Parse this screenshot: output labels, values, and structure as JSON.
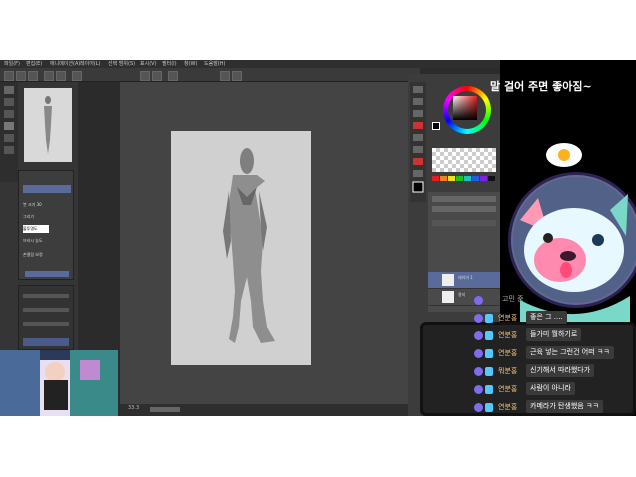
{
  "app": {
    "window_title": "",
    "menus": [
      "파일(F)",
      "편집(E)",
      "애니메이션(A)",
      "레이어(L)",
      "선택 범위(S)",
      "표시(V)",
      "필터(I)",
      "창(W)",
      "도움말(H)"
    ],
    "subtool_items": [
      "붓 크기 30",
      "그리기",
      "불투명도",
      "브러시 농도",
      "손떨림 보정"
    ],
    "canvas_scroll_label": "33.3",
    "layers": [
      {
        "name": "레이어 1"
      },
      {
        "name": "용지"
      }
    ],
    "palette_colors": [
      "#e02020",
      "#f08020",
      "#f0e020",
      "#20c020",
      "#20c0c0",
      "#2060e0",
      "#8020e0",
      "#101010"
    ]
  },
  "overlay": {
    "caption": "말 걸어 주면 좋아짐~",
    "chat": [
      {
        "name": "닉네임",
        "message": "고민 중"
      },
      {
        "name": "연분홍",
        "message": "좋은 그 ...."
      },
      {
        "name": "연분홍",
        "message": "들가미 뭘하기로"
      },
      {
        "name": "연분홍",
        "message": "근육 넣는 그런건 어떠 ㅋㅋ"
      },
      {
        "name": "뭐분홍",
        "message": "신기해서 따라했다가"
      },
      {
        "name": "연분홍",
        "message": "사람이 아니라"
      },
      {
        "name": "연분홍",
        "message": "카메라가 탄생했음 ㅋㅋ"
      }
    ]
  }
}
